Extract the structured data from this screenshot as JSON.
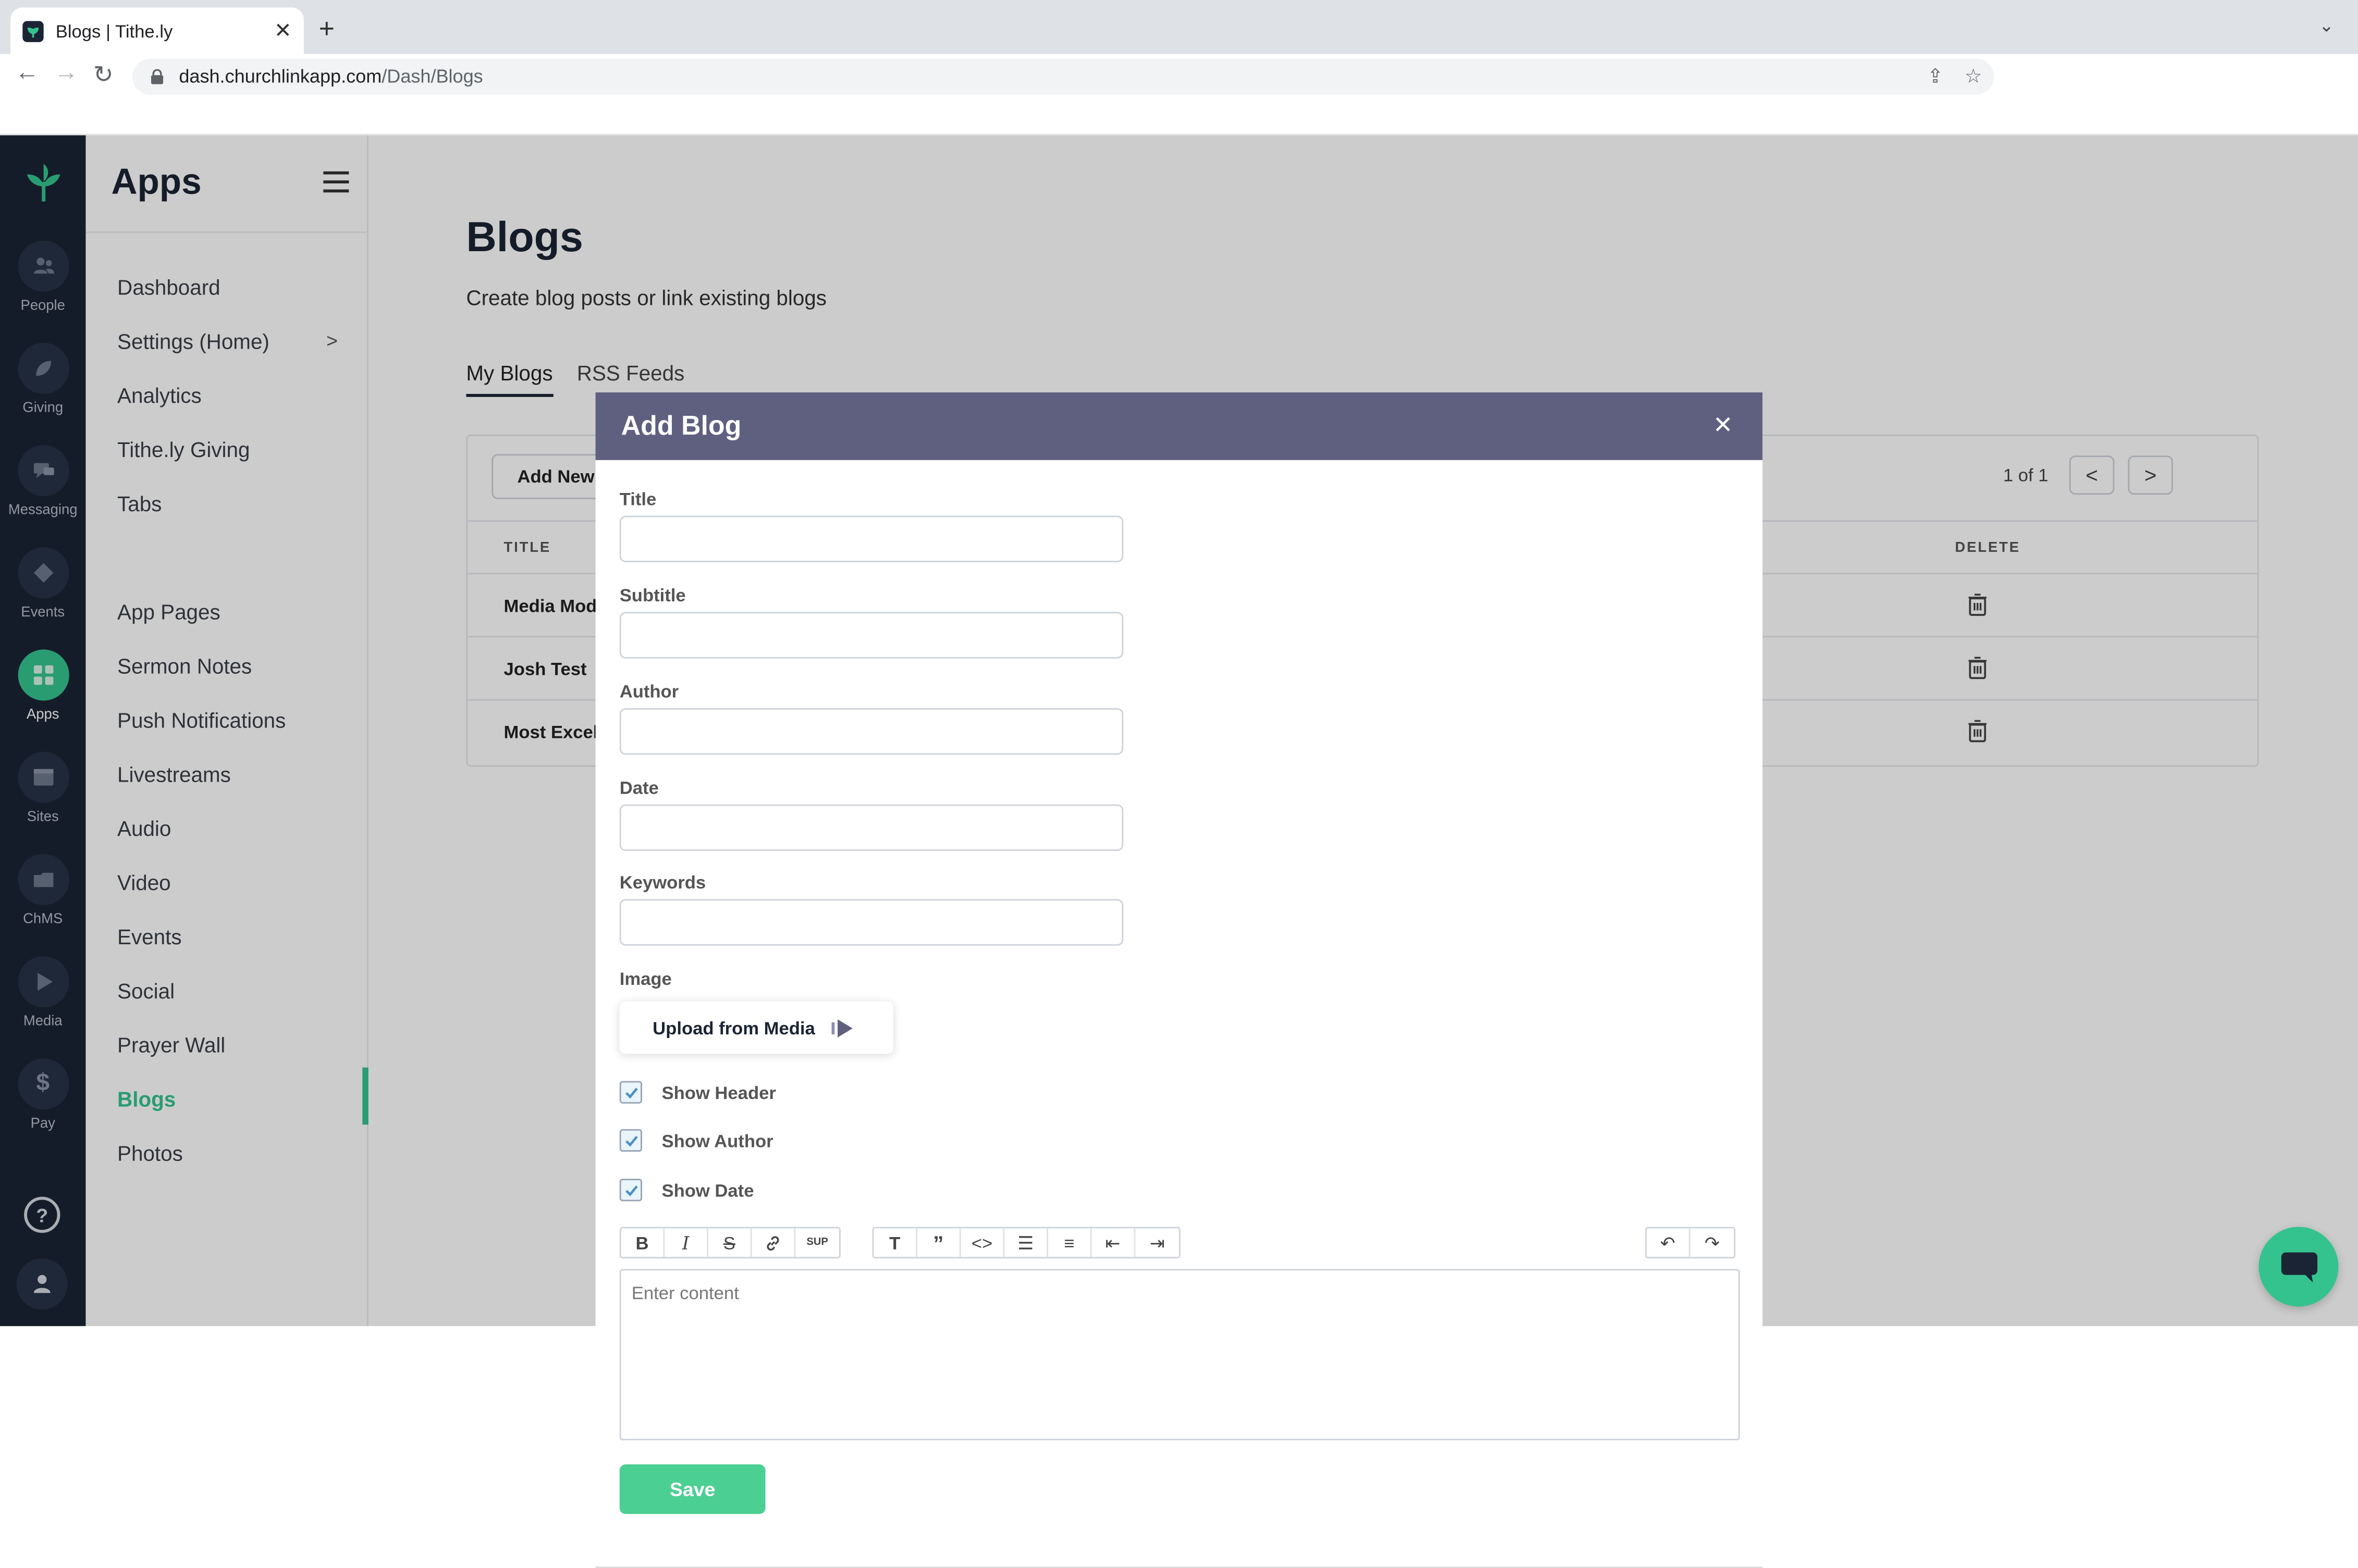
{
  "browser": {
    "tab_title": "Blogs | Tithe.ly",
    "new_tab": "+",
    "url_host": "dash.churchlinkapp.com",
    "url_path": "/Dash/Blogs"
  },
  "rail": {
    "items": [
      {
        "label": "People",
        "icon": "people-icon"
      },
      {
        "label": "Giving",
        "icon": "giving-icon"
      },
      {
        "label": "Messaging",
        "icon": "messaging-icon"
      },
      {
        "label": "Events",
        "icon": "events-icon"
      },
      {
        "label": "Apps",
        "icon": "apps-icon"
      },
      {
        "label": "Sites",
        "icon": "sites-icon"
      },
      {
        "label": "ChMS",
        "icon": "chms-icon"
      },
      {
        "label": "Media",
        "icon": "media-icon"
      },
      {
        "label": "Pay",
        "icon": "pay-icon"
      }
    ],
    "help": "?"
  },
  "sidebar": {
    "title": "Apps",
    "items": [
      {
        "label": "Dashboard"
      },
      {
        "label": "Settings (Home)"
      },
      {
        "label": "Analytics"
      },
      {
        "label": "Tithe.ly Giving"
      },
      {
        "label": "Tabs"
      },
      {
        "label": "App Pages"
      },
      {
        "label": "Sermon Notes"
      },
      {
        "label": "Push Notifications"
      },
      {
        "label": "Livestreams"
      },
      {
        "label": "Audio"
      },
      {
        "label": "Video"
      },
      {
        "label": "Events"
      },
      {
        "label": "Social"
      },
      {
        "label": "Prayer Wall"
      },
      {
        "label": "Blogs"
      },
      {
        "label": "Photos"
      }
    ]
  },
  "main": {
    "title": "Blogs",
    "subtitle": "Create blog posts or link existing blogs",
    "tabs": [
      {
        "label": "My Blogs"
      },
      {
        "label": "RSS Feeds"
      }
    ],
    "add_new": "Add New",
    "pager": "1 of 1",
    "columns": {
      "title": "TITLE",
      "delete": "DELETE"
    },
    "rows": [
      {
        "title": "Media Mod"
      },
      {
        "title": "Josh Test"
      },
      {
        "title": "Most Excel"
      }
    ]
  },
  "modal": {
    "title": "Add Blog",
    "close": "✕",
    "fields": [
      {
        "label": "Title",
        "value": ""
      },
      {
        "label": "Subtitle",
        "value": ""
      },
      {
        "label": "Author",
        "value": ""
      },
      {
        "label": "Date",
        "value": ""
      },
      {
        "label": "Keywords",
        "value": ""
      }
    ],
    "image_label": "Image",
    "upload_label": "Upload from Media",
    "checkboxes": [
      {
        "label": "Show Header",
        "checked": true
      },
      {
        "label": "Show Author",
        "checked": true
      },
      {
        "label": "Show Date",
        "checked": true
      }
    ],
    "editor": {
      "sup_label": "SUP",
      "placeholder": "Enter content"
    },
    "save_label": "Save"
  },
  "colors": {
    "accent": "#34c38f",
    "rail": "#1b2434",
    "modal_header": "#5f5f80"
  }
}
